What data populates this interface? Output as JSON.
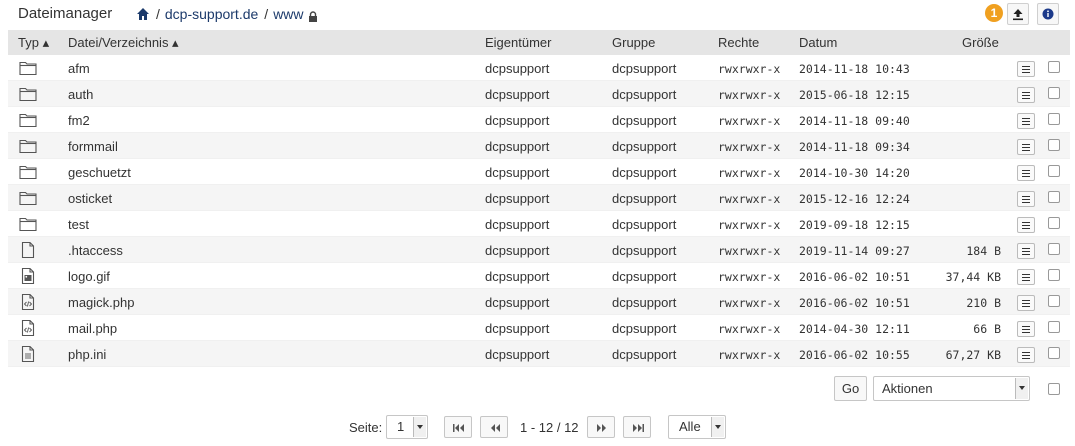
{
  "header": {
    "title": "Dateimanager",
    "breadcrumb": [
      "dcp-support.de",
      "www"
    ],
    "separator": "/",
    "badge": "1",
    "icons": {
      "home": "home-icon",
      "lock": "lock-icon",
      "upload": "upload-icon",
      "info": "info-icon"
    }
  },
  "table": {
    "columns": {
      "type": "Typ ▴",
      "name": "Datei/Verzeichnis ▴",
      "owner": "Eigentümer",
      "group": "Gruppe",
      "rights": "Rechte",
      "date": "Datum",
      "size": "Größe"
    },
    "rows": [
      {
        "icon": "folder-icon",
        "name": "afm",
        "owner": "dcpsupport",
        "group": "dcpsupport",
        "rights": "rwxrwxr-x",
        "date": "2014-11-18 10:43",
        "size": ""
      },
      {
        "icon": "folder-icon",
        "name": "auth",
        "owner": "dcpsupport",
        "group": "dcpsupport",
        "rights": "rwxrwxr-x",
        "date": "2015-06-18 12:15",
        "size": ""
      },
      {
        "icon": "folder-icon",
        "name": "fm2",
        "owner": "dcpsupport",
        "group": "dcpsupport",
        "rights": "rwxrwxr-x",
        "date": "2014-11-18 09:40",
        "size": ""
      },
      {
        "icon": "folder-icon",
        "name": "formmail",
        "owner": "dcpsupport",
        "group": "dcpsupport",
        "rights": "rwxrwxr-x",
        "date": "2014-11-18 09:34",
        "size": ""
      },
      {
        "icon": "folder-icon",
        "name": "geschuetzt",
        "owner": "dcpsupport",
        "group": "dcpsupport",
        "rights": "rwxrwxr-x",
        "date": "2014-10-30 14:20",
        "size": ""
      },
      {
        "icon": "folder-icon",
        "name": "osticket",
        "owner": "dcpsupport",
        "group": "dcpsupport",
        "rights": "rwxrwxr-x",
        "date": "2015-12-16 12:24",
        "size": ""
      },
      {
        "icon": "folder-icon",
        "name": "test",
        "owner": "dcpsupport",
        "group": "dcpsupport",
        "rights": "rwxrwxr-x",
        "date": "2019-09-18 12:15",
        "size": ""
      },
      {
        "icon": "file-icon",
        "name": ".htaccess",
        "owner": "dcpsupport",
        "group": "dcpsupport",
        "rights": "rwxrwxr-x",
        "date": "2019-11-14 09:27",
        "size": "184 B"
      },
      {
        "icon": "image-file-icon",
        "name": "logo.gif",
        "owner": "dcpsupport",
        "group": "dcpsupport",
        "rights": "rwxrwxr-x",
        "date": "2016-06-02 10:51",
        "size": "37,44 KB"
      },
      {
        "icon": "code-file-icon",
        "name": "magick.php",
        "owner": "dcpsupport",
        "group": "dcpsupport",
        "rights": "rwxrwxr-x",
        "date": "2016-06-02 10:51",
        "size": "210 B"
      },
      {
        "icon": "code-file-icon",
        "name": "mail.php",
        "owner": "dcpsupport",
        "group": "dcpsupport",
        "rights": "rwxrwxr-x",
        "date": "2014-04-30 12:11",
        "size": "66 B"
      },
      {
        "icon": "text-file-icon",
        "name": "php.ini",
        "owner": "dcpsupport",
        "group": "dcpsupport",
        "rights": "rwxrwxr-x",
        "date": "2016-06-02 10:55",
        "size": "67,27 KB"
      }
    ]
  },
  "actions": {
    "go_label": "Go",
    "select_value": "Aktionen"
  },
  "pager": {
    "label": "Seite:",
    "page_value": "1",
    "range": "1 - 12 / 12",
    "per_page": "Alle"
  }
}
